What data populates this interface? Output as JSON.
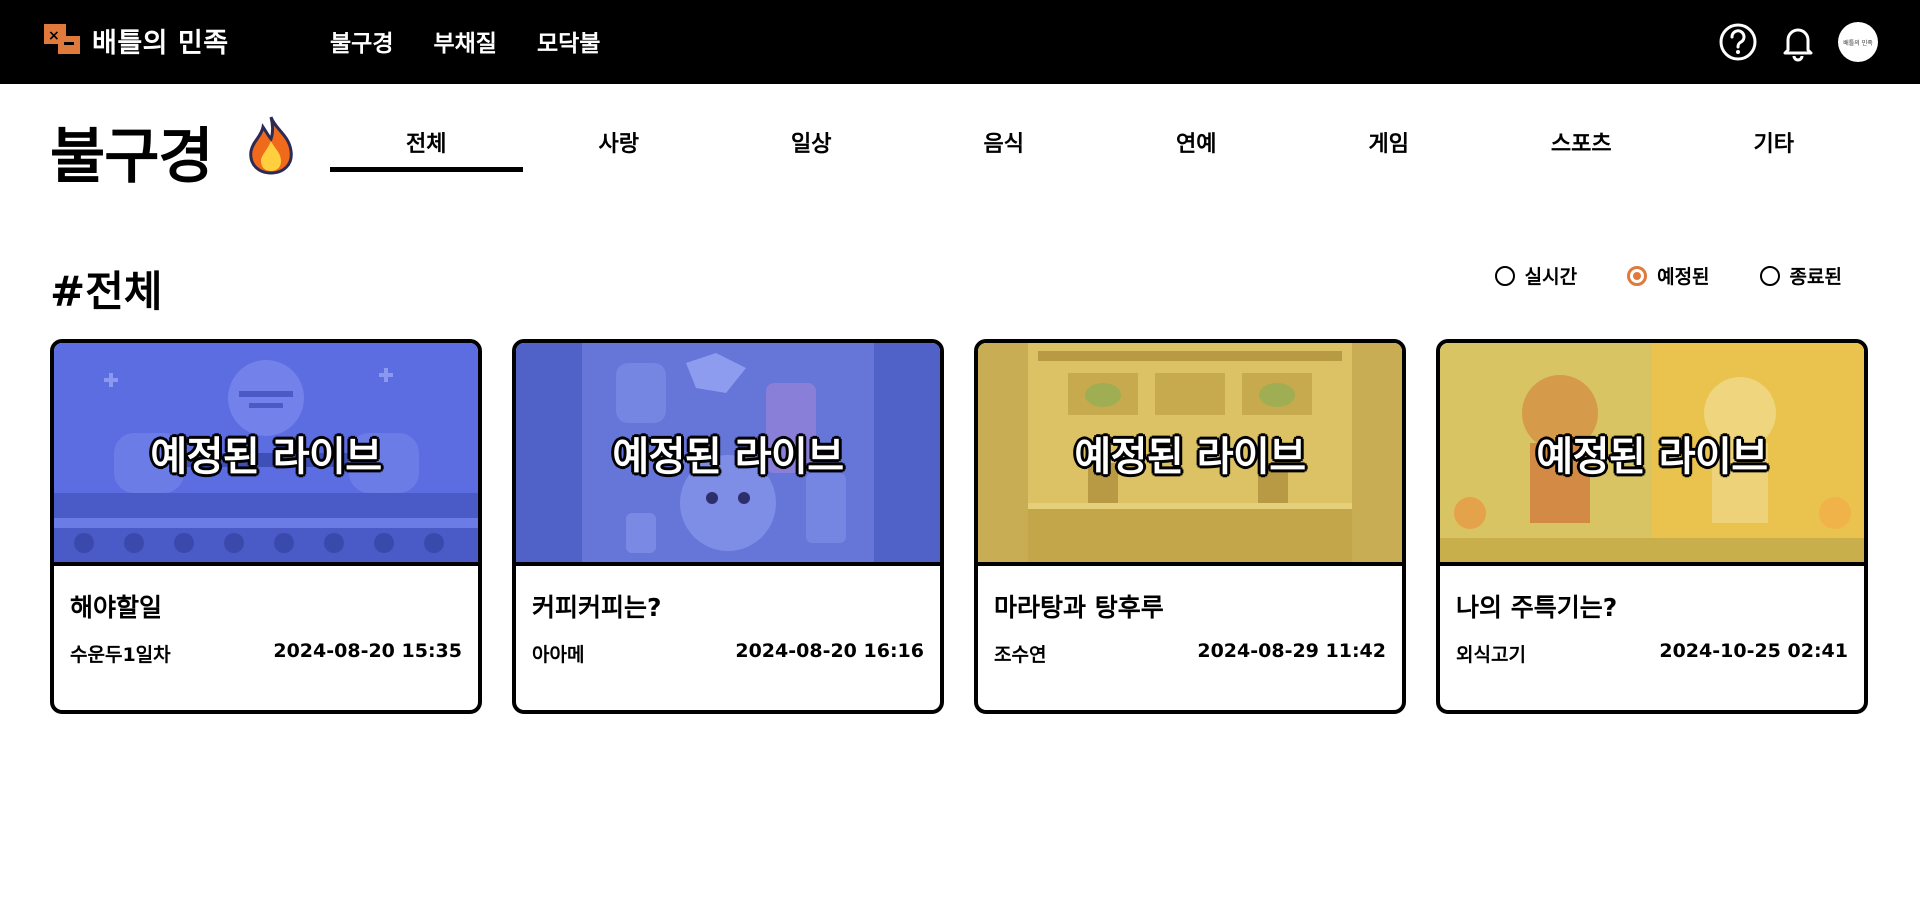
{
  "header": {
    "logo_text": "배틀의 민족",
    "nav": [
      "불구경",
      "부채질",
      "모닥불"
    ],
    "avatar_text": "배틀의 민족"
  },
  "page": {
    "title": "불구경",
    "tabs": [
      "전체",
      "사랑",
      "일상",
      "음식",
      "연예",
      "게임",
      "스포츠",
      "기타"
    ],
    "active_tab": "전체",
    "section_title": "#전체",
    "filters": [
      {
        "label": "실시간",
        "checked": false
      },
      {
        "label": "예정된",
        "checked": true
      },
      {
        "label": "종료된",
        "checked": false
      }
    ]
  },
  "cards": [
    {
      "overlay": "예정된 라이브",
      "title": "해야할일",
      "author": "수운두1일차",
      "datetime": "2024-08-20 15:35",
      "theme": "blue-stage"
    },
    {
      "overlay": "예정된 라이브",
      "title": "커피커피는?",
      "author": "아아메",
      "datetime": "2024-08-20 16:16",
      "theme": "blue-coffee"
    },
    {
      "overlay": "예정된 라이브",
      "title": "마라탕과 탕후루",
      "author": "조수연",
      "datetime": "2024-08-29 11:42",
      "theme": "yellow-arcade"
    },
    {
      "overlay": "예정된 라이브",
      "title": "나의 주특기는?",
      "author": "외식고기",
      "datetime": "2024-10-25 02:41",
      "theme": "yellow-duel"
    }
  ],
  "colors": {
    "accent": "#e07a3c",
    "topbar": "#000000",
    "card_blue": "#5566d4",
    "card_yellow": "#e3c35a"
  }
}
